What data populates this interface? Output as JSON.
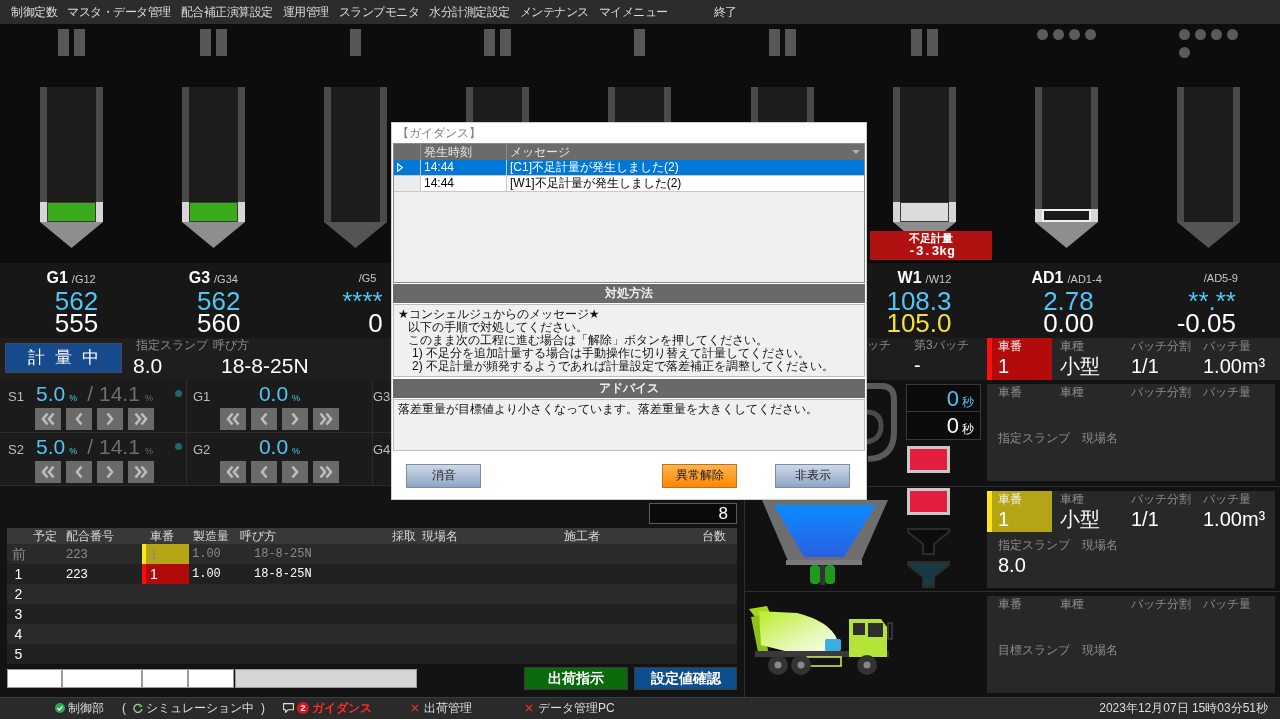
{
  "menu": [
    {
      "label": "制御定数"
    },
    {
      "label": "マスタ・データ管理"
    },
    {
      "label": "配合補正演算設定"
    },
    {
      "label": "運用管理"
    },
    {
      "label": "スランプモニタ"
    },
    {
      "label": "水分計測定設定"
    },
    {
      "label": "メンテナンス"
    },
    {
      "label": "マイメニュー"
    },
    {
      "label": "終了"
    }
  ],
  "hoppers": [
    {
      "gates": [
        {
          "kind": "bar"
        },
        {
          "kind": "bar"
        }
      ],
      "covered": false,
      "fill": {
        "kind": "solid",
        "color": "#3bab1b",
        "level": 0.15
      },
      "active": true,
      "name": "G1",
      "group": "/G12",
      "target": "562",
      "actual": "555",
      "warn": false
    },
    {
      "gates": [
        {
          "kind": "bar"
        },
        {
          "kind": "bar"
        }
      ],
      "covered": false,
      "fill": {
        "kind": "solid",
        "color": "#3bab1b",
        "level": 0.15
      },
      "active": true,
      "name": "G3",
      "group": "/G34",
      "target": "562",
      "actual": "560",
      "warn": false
    },
    {
      "gates": [
        {
          "kind": "bar"
        }
      ],
      "covered": false,
      "active": false,
      "group": "/G5",
      "target": "****",
      "actual": "0",
      "warn": false
    },
    {
      "gates": [
        {
          "kind": "bar"
        },
        {
          "kind": "bar"
        }
      ],
      "covered": true
    },
    {
      "gates": [
        {
          "kind": "bar"
        }
      ],
      "covered": true
    },
    {
      "gates": [
        {
          "kind": "bar"
        },
        {
          "kind": "bar"
        }
      ],
      "covered": true
    },
    {
      "gates": [
        {
          "kind": "bar"
        },
        {
          "kind": "bar"
        }
      ],
      "covered": false,
      "fill": {
        "kind": "solid",
        "color": "#dcdcdc",
        "level": 0.15
      },
      "active": true,
      "alert": {
        "title": "不足計量",
        "value": "-3.3kg"
      },
      "name": "W1",
      "group": "/W12",
      "target": "108.3",
      "actual": "105.0",
      "warn": true
    },
    {
      "gates": [
        {
          "kind": "dot"
        },
        {
          "kind": "dot"
        },
        {
          "kind": "dot"
        },
        {
          "kind": "dot"
        }
      ],
      "covered": false,
      "fill": {
        "kind": "outline",
        "level": 0.1
      },
      "active": true,
      "name": "AD1",
      "group": "/AD1-4",
      "target": "2.78",
      "actual": "0.00",
      "warn": false
    },
    {
      "gates": [
        {
          "kind": "dot"
        },
        {
          "kind": "dot"
        },
        {
          "kind": "dot"
        },
        {
          "kind": "dot"
        },
        {
          "kind": "dot"
        }
      ],
      "covered": false,
      "active": false,
      "group": "/AD5-9",
      "target": "**.**",
      "actual": "-0.05",
      "warn": false
    }
  ],
  "mode_panel": {
    "status": "計量中",
    "fields": [
      {
        "label": "指定スランプ",
        "value": "8.0"
      },
      {
        "label": "呼び方",
        "value": "18-8-25N"
      }
    ]
  },
  "batches": [
    {
      "label": "ッチ"
    },
    {
      "label": "第3バッチ",
      "value": "-"
    }
  ],
  "current_vehicle": {
    "color": "#b30b0b",
    "fields": [
      {
        "label": "車番",
        "value": "1"
      },
      {
        "label": "車種",
        "value": "小型"
      },
      {
        "label": "バッチ分割",
        "value": "1/1"
      },
      {
        "label": "バッチ量",
        "value": "1.00m³"
      }
    ]
  },
  "adjustments": [
    {
      "cells": [
        {
          "name": "S1",
          "value": "5.0",
          "unit": "%",
          "limit": "/ 14.1",
          "limit_unit": "%",
          "indicator": true
        },
        {
          "name": "G1",
          "value": "0.0",
          "unit": "%",
          "indicator": false
        },
        {
          "name": "G3",
          "indicator": false
        }
      ]
    },
    {
      "cells": [
        {
          "name": "S2",
          "value": "5.0",
          "unit": "%",
          "limit": "/ 14.1",
          "limit_unit": "%",
          "indicator": true
        },
        {
          "name": "G2",
          "value": "0.0",
          "unit": "%",
          "indicator": false
        },
        {
          "name": "G4",
          "indicator": false
        }
      ]
    }
  ],
  "timers": [
    {
      "kind": "target",
      "value": "0",
      "unit": "秒"
    },
    {
      "kind": "actual",
      "value": "0",
      "unit": "秒"
    }
  ],
  "lamps": [
    {
      "on": true
    },
    {
      "on": true
    }
  ],
  "vehicle_queue": [
    {
      "fields": [
        {
          "label": "車番"
        },
        {
          "label": "車種"
        },
        {
          "label": "バッチ分割"
        },
        {
          "label": "バッチ量"
        }
      ],
      "details": [
        {
          "label": "指定スランプ"
        },
        {
          "label": "現場名"
        }
      ]
    },
    {
      "color": "#b5a514",
      "fields": [
        {
          "label": "車番",
          "value": "1"
        },
        {
          "label": "車種",
          "value": "小型"
        },
        {
          "label": "バッチ分割",
          "value": "1/1"
        },
        {
          "label": "バッチ量",
          "value": "1.00m³"
        }
      ],
      "details": [
        {
          "label": "指定スランプ",
          "value": "8.0"
        },
        {
          "label": "現場名"
        }
      ]
    },
    {
      "fields": [
        {
          "label": "車番"
        },
        {
          "label": "車種"
        },
        {
          "label": "バッチ分割"
        },
        {
          "label": "バッチ量"
        }
      ],
      "details": [
        {
          "label": "目標スランプ"
        },
        {
          "label": "現場名"
        }
      ]
    }
  ],
  "table": {
    "counter": "8",
    "columns": [
      "予定",
      "配合番号",
      "車番",
      "製造量",
      "呼び方",
      "採取",
      "現場名",
      "施工者",
      "台数"
    ],
    "rows": [
      {
        "order": "前",
        "mix": "223",
        "car": {
          "value": "1",
          "color": "#b5a514"
        },
        "amount": "1.00",
        "grade": "18-8-25N",
        "dimmed": true
      },
      {
        "order": "1",
        "mix": "223",
        "car": {
          "value": "1",
          "color": "#b00a0a"
        },
        "amount": "1.00",
        "grade": "18-8-25N",
        "dimmed": false
      },
      {
        "order": "2",
        "dimmed": false
      },
      {
        "order": "3",
        "dimmed": false
      },
      {
        "order": "4",
        "dimmed": false
      },
      {
        "order": "5",
        "dimmed": false
      }
    ]
  },
  "inputs": [
    {
      "disabled": false
    },
    {
      "disabled": false
    },
    {
      "disabled": false
    },
    {
      "disabled": false
    },
    {
      "disabled": true
    }
  ],
  "actions": [
    {
      "label": "出荷指示",
      "color": "#0b6a0b"
    },
    {
      "label": "設定値確認",
      "color": "#0f4e8c"
    }
  ],
  "dialog": {
    "title": "【ガイダンス】",
    "columns": [
      "発生時刻",
      "メッセージ"
    ],
    "rows": [
      {
        "time": "14:44",
        "message": "[C1]不足計量が発生しました(2)",
        "selected": true
      },
      {
        "time": "14:44",
        "message": "[W1]不足計量が発生しました(2)",
        "selected": false
      }
    ],
    "sections": [
      {
        "title": "対処方法",
        "lines": [
          {
            "text": "★コンシェルジュからのメッセージ★",
            "children": [
              {
                "text": "以下の手順で対処してください。"
              },
              {
                "text": "このまま次の工程に進む場合は「解除」ボタンを押してください。",
                "children": [
                  {
                    "text": "1) 不足分を追加計量する場合は手動操作に切り替えて計量してください。"
                  },
                  {
                    "text": "2) 不足計量が頻発するようであれば計量設定で落差補正を調整してください。"
                  }
                ]
              }
            ]
          }
        ]
      },
      {
        "title": "アドバイス",
        "lines": [
          {
            "text": "落差重量が目標値より小さくなっています。落差重量を大きくしてください。"
          }
        ]
      }
    ],
    "buttons": [
      {
        "label": "消音",
        "kind": "plain"
      },
      {
        "label": "異常解除",
        "kind": "warning"
      },
      {
        "label": "非表示",
        "kind": "plain"
      }
    ]
  },
  "status_bar": {
    "items": [
      {
        "kind": "ok",
        "label": "制御部"
      },
      {
        "kind": "sim",
        "open": "(",
        "label": "シミュレーション中",
        "close": ")"
      },
      {
        "kind": "alert",
        "count": "2",
        "label": "ガイダンス"
      },
      {
        "kind": "error",
        "label": "出荷管理"
      },
      {
        "kind": "error",
        "label": "データ管理PC"
      }
    ],
    "clock": "2023年12月07日 15時03分51秒"
  }
}
